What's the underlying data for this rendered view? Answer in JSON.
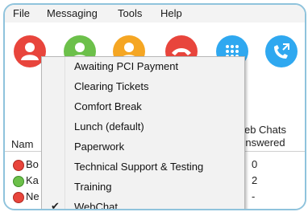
{
  "menubar": {
    "items": [
      {
        "label": "File"
      },
      {
        "label": "Messaging"
      },
      {
        "label": "Tools"
      },
      {
        "label": "Help"
      }
    ]
  },
  "toolbar": {
    "buttons": [
      {
        "icon": "user-icon",
        "color": "#e8453c"
      },
      {
        "icon": "user-icon",
        "color": "#6cc04a"
      },
      {
        "icon": "user-icon",
        "color": "#f5a623"
      },
      {
        "icon": "hangup-icon",
        "color": "#e8453c"
      },
      {
        "icon": "dialpad-icon",
        "color": "#2fa8f0"
      },
      {
        "icon": "call-transfer-icon",
        "color": "#2fa8f0"
      }
    ]
  },
  "grid": {
    "col_name": "Nam",
    "col_chats_line1": "eb Chats",
    "col_chats_line2": "nswered",
    "rows": [
      {
        "name": "Bo",
        "status_color": "#e8453c",
        "value": "0"
      },
      {
        "name": "Ka",
        "status_color": "#6cc04a",
        "value": "2"
      },
      {
        "name": "Ne",
        "status_color": "#e8453c",
        "value": "-"
      }
    ]
  },
  "status_menu": {
    "items": [
      {
        "label": "Awaiting PCI Payment",
        "checked": false
      },
      {
        "label": "Clearing Tickets",
        "checked": false
      },
      {
        "label": "Comfort Break",
        "checked": false
      },
      {
        "label": "Lunch (default)",
        "checked": false
      },
      {
        "label": "Paperwork",
        "checked": false
      },
      {
        "label": "Technical Support & Testing",
        "checked": false
      },
      {
        "label": "Training",
        "checked": false
      },
      {
        "label": "WebChat",
        "checked": true
      }
    ],
    "check_glyph": "✔"
  }
}
